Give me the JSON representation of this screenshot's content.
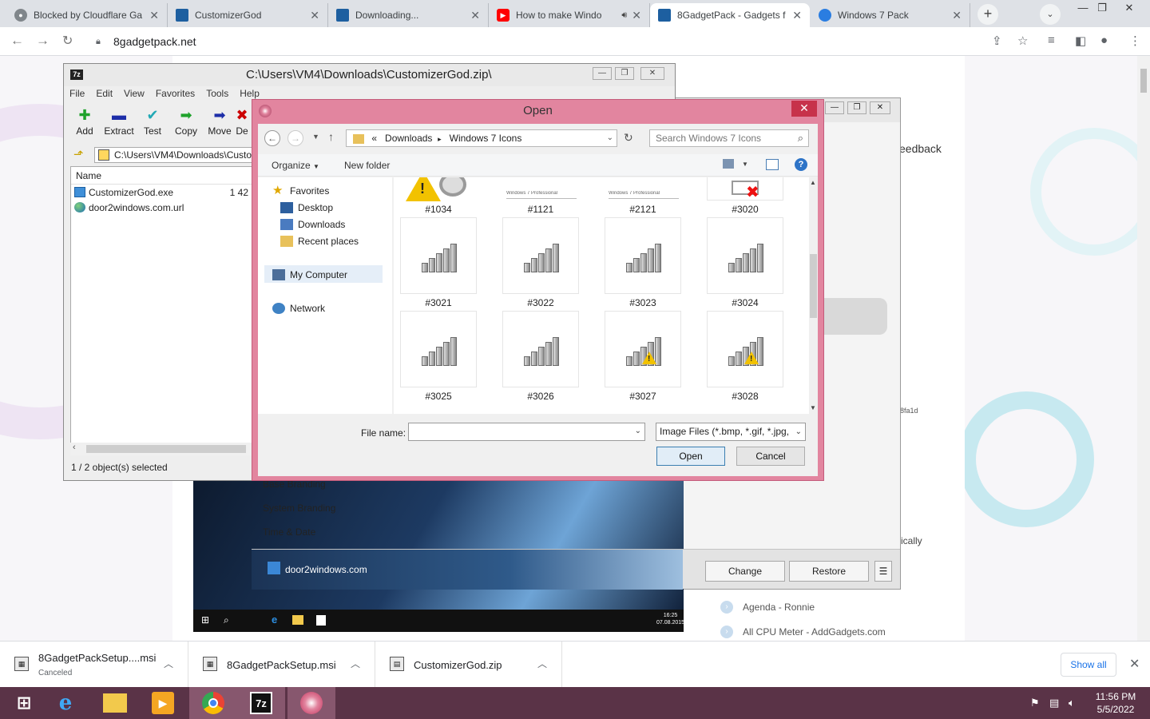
{
  "browser": {
    "tabs": [
      {
        "title": "Blocked by Cloudflare Ga",
        "favicon": "cloudflare-icon"
      },
      {
        "title": "CustomizerGod",
        "favicon": "page-icon"
      },
      {
        "title": "Downloading...",
        "favicon": "page-icon"
      },
      {
        "title": "How to make Windo",
        "favicon": "youtube-icon"
      },
      {
        "title": "8GadgetPack - Gadgets f",
        "favicon": "page-icon"
      },
      {
        "title": "Windows 7 Pack",
        "favicon": "windows-icon"
      }
    ],
    "url": "8gadgetpack.net"
  },
  "page": {
    "feedback_label": "eedback",
    "hash_fragment": "8fa1d",
    "tail_text": "ically",
    "gadgets": [
      "Agenda - Ronnie",
      "All CPU Meter - AddGadgets.com"
    ]
  },
  "customizergod": {
    "sidebar": [
      "Base Branding",
      "System Branding",
      "Time & Date"
    ],
    "link": "door2windows.com",
    "change_label": "Change",
    "restore_label": "Restore",
    "taskbar_clock": [
      "16:25",
      "07.08.2015"
    ]
  },
  "sevenzip": {
    "title": "C:\\Users\\VM4\\Downloads\\CustomizerGod.zip\\",
    "menu": [
      "File",
      "Edit",
      "View",
      "Favorites",
      "Tools",
      "Help"
    ],
    "tools": [
      "Add",
      "Extract",
      "Test",
      "Copy",
      "Move",
      "De"
    ],
    "address": "C:\\Users\\VM4\\Downloads\\Custo",
    "column_name": "Name",
    "size_fragment": "1 42",
    "files": [
      "CustomizerGod.exe",
      "door2windows.com.url"
    ],
    "status": "1 / 2 object(s) selected"
  },
  "dialog": {
    "title": "Open",
    "path": [
      "«",
      "Downloads",
      "Windows 7 Icons"
    ],
    "search_placeholder": "Search Windows 7 Icons",
    "organize_label": "Organize",
    "new_folder_label": "New folder",
    "nav": {
      "favorites": "Favorites",
      "desktop": "Desktop",
      "downloads": "Downloads",
      "recent": "Recent places",
      "computer": "My Computer",
      "network": "Network"
    },
    "files": [
      {
        "label": "#1034",
        "kind": "warning-drive"
      },
      {
        "label": "#1121",
        "kind": "banner",
        "caption": "Windows 7 Professional"
      },
      {
        "label": "#2121",
        "kind": "banner",
        "caption": "Windows 7 Professional"
      },
      {
        "label": "#3020",
        "kind": "network-error"
      },
      {
        "label": "#3021",
        "kind": "signal"
      },
      {
        "label": "#3022",
        "kind": "signal"
      },
      {
        "label": "#3023",
        "kind": "signal"
      },
      {
        "label": "#3024",
        "kind": "signal"
      },
      {
        "label": "#3025",
        "kind": "signal"
      },
      {
        "label": "#3026",
        "kind": "signal"
      },
      {
        "label": "#3027",
        "kind": "signal-warning"
      },
      {
        "label": "#3028",
        "kind": "signal-warning"
      }
    ],
    "file_name_label": "File name:",
    "file_name_value": "",
    "filter": "Image Files (*.bmp, *.gif, *.jpg,",
    "open_label": "Open",
    "cancel_label": "Cancel"
  },
  "downloads": {
    "items": [
      {
        "name": "8GadgetPackSetup....msi",
        "status": "Canceled"
      },
      {
        "name": "8GadgetPackSetup.msi",
        "status": ""
      },
      {
        "name": "CustomizerGod.zip",
        "status": ""
      }
    ],
    "show_all": "Show all"
  },
  "taskbar": {
    "time": "11:56 PM",
    "date": "5/5/2022"
  },
  "colors": {
    "dialog_frame": "#e2859f",
    "taskbar": "#5a3347",
    "link": "#1a73e8"
  }
}
